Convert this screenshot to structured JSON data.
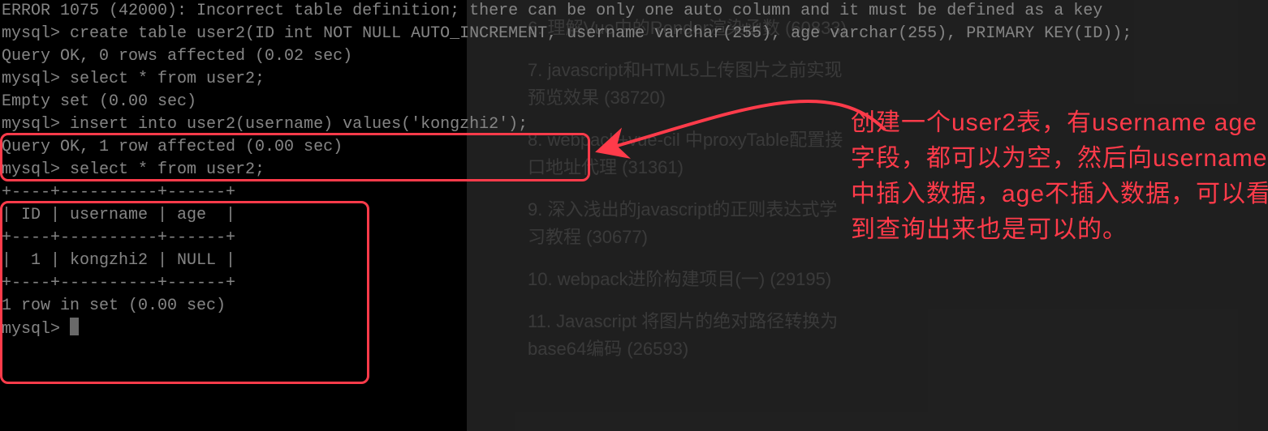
{
  "terminal": {
    "lines": [
      "ERROR 1075 (42000): Incorrect table definition; there can be only one auto column and it must be defined as a key",
      "mysql> create table user2(ID int NOT NULL AUTO_INCREMENT, username varchar(255), age varchar(255), PRIMARY KEY(ID));",
      "Query OK, 0 rows affected (0.02 sec)",
      "",
      "mysql> select * from user2;",
      "Empty set (0.00 sec)",
      "",
      "mysql> insert into user2(username) values('kongzhi2');",
      "Query OK, 1 row affected (0.00 sec)",
      "",
      "mysql> select * from user2;",
      "+----+----------+------+",
      "| ID | username | age  |",
      "+----+----------+------+",
      "|  1 | kongzhi2 | NULL |",
      "+----+----------+------+",
      "1 row in set (0.00 sec)",
      "",
      "mysql> "
    ],
    "prompt_cursor_line_index": 18
  },
  "annotation": {
    "text": "创建一个user2表，有username age字段，都可以为空，然后向username中插入数据，age不插入数据，可以看到查询出来也是可以的。"
  },
  "sidebar": {
    "items": [
      {
        "label": "6. 理解Vue中的Render渲染函数",
        "count": "(60833)"
      },
      {
        "label": "7. javascript和HTML5上传图片之前实现预览效果",
        "count": "(38720)"
      },
      {
        "label": "8. webpack+vue-cil 中proxyTable配置接口地址代理",
        "count": "(31361)"
      },
      {
        "label": "9. 深入浅出的javascript的正则表达式学习教程",
        "count": "(30677)"
      },
      {
        "label": "10. webpack进阶构建项目(一)",
        "count": "(29195)"
      },
      {
        "label": "11. Javascript 将图片的绝对路径转换为base64编码",
        "count": "(26593)"
      }
    ]
  },
  "colors": {
    "highlight": "#ff3b4a",
    "terminal_bg": "#000000",
    "terminal_fg": "#f0f0f0",
    "sidebar_fg": "#6b6b6b"
  }
}
